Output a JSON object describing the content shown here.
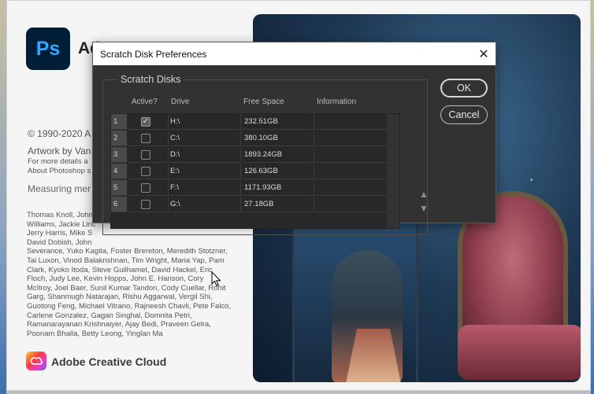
{
  "splash": {
    "logo_text": "Ps",
    "app_title": "Ado",
    "copyright": "© 1990-2020 A",
    "artwork": "Artwork by Van",
    "details_line1": "For more details a",
    "details_line2": "About Photoshop s",
    "measuring": "Measuring mer",
    "credits": [
      "Thomas Knoll, John",
      "Williams, Jackie Linc",
      "Jerry Harris, Mike S",
      "David Dobish, John",
      "Severance, Yuko Kagita, Foster Brereton, Meredith Stotzner,",
      "Tai Luxon, Vinod Balakrishnan, Tim Wright, Maria Yap, Pam",
      "Clark, Kyoko Itoda, Steve Guilhamet, David Hackel, Eric",
      "Floch, Judy Lee, Kevin Hopps, John E. Hanson, Cory",
      "McIlroy, Joel Baer, Sunil Kumar Tandon, Cody Cuellar, Rohit",
      "Garg, Shanmugh Natarajan, Rishu Aggarwal, Vergil Shi,",
      "Guotong Feng, Michael Vitrano, Rajneesh Chavli, Pete Falco,",
      "Carlene Gonzalez, Gagan Singhal, Domnita Petri,",
      "Ramanarayanan Krishnaiyer, Ajay Bedi, Praveen Gelra,",
      "Poonam Bhalla, Betty Leong, Yinglan Ma"
    ],
    "cc_name": "Adobe Creative Cloud"
  },
  "dialog": {
    "title": "Scratch Disk Preferences",
    "close_glyph": "✕",
    "group_label": "Scratch Disks",
    "columns": {
      "active": "Active?",
      "drive": "Drive",
      "free": "Free Space",
      "info": "Information"
    },
    "rows": [
      {
        "index": "1",
        "active": true,
        "drive": "H:\\",
        "free": "232.51GB",
        "info": ""
      },
      {
        "index": "2",
        "active": false,
        "drive": "C:\\",
        "free": "380.10GB",
        "info": ""
      },
      {
        "index": "3",
        "active": false,
        "drive": "D:\\",
        "free": "1893.24GB",
        "info": ""
      },
      {
        "index": "4",
        "active": false,
        "drive": "E:\\",
        "free": "126.63GB",
        "info": ""
      },
      {
        "index": "5",
        "active": false,
        "drive": "F:\\",
        "free": "1171.93GB",
        "info": ""
      },
      {
        "index": "6",
        "active": false,
        "drive": "G:\\",
        "free": "27.18GB",
        "info": ""
      }
    ],
    "move_up_glyph": "▲",
    "move_down_glyph": "▼",
    "ok_label": "OK",
    "cancel_label": "Cancel"
  },
  "colors": {
    "dialog_bg": "#323232",
    "ps_logo_bg": "#001e36",
    "ps_logo_fg": "#31a8ff"
  }
}
